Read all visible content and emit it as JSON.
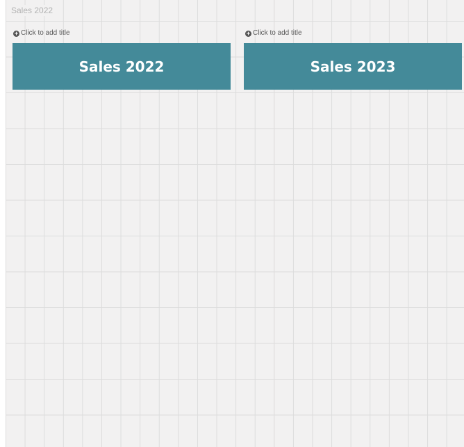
{
  "sheet": {
    "title": "Sales 2022"
  },
  "panels": [
    {
      "add_title_label": "Click to add title",
      "button_label": "Sales 2022",
      "button_color": "#448a99"
    },
    {
      "add_title_label": "Click to add title",
      "button_label": "Sales 2023",
      "button_color": "#448a99"
    }
  ],
  "icons": {
    "add_title": "plus-circle-icon"
  }
}
